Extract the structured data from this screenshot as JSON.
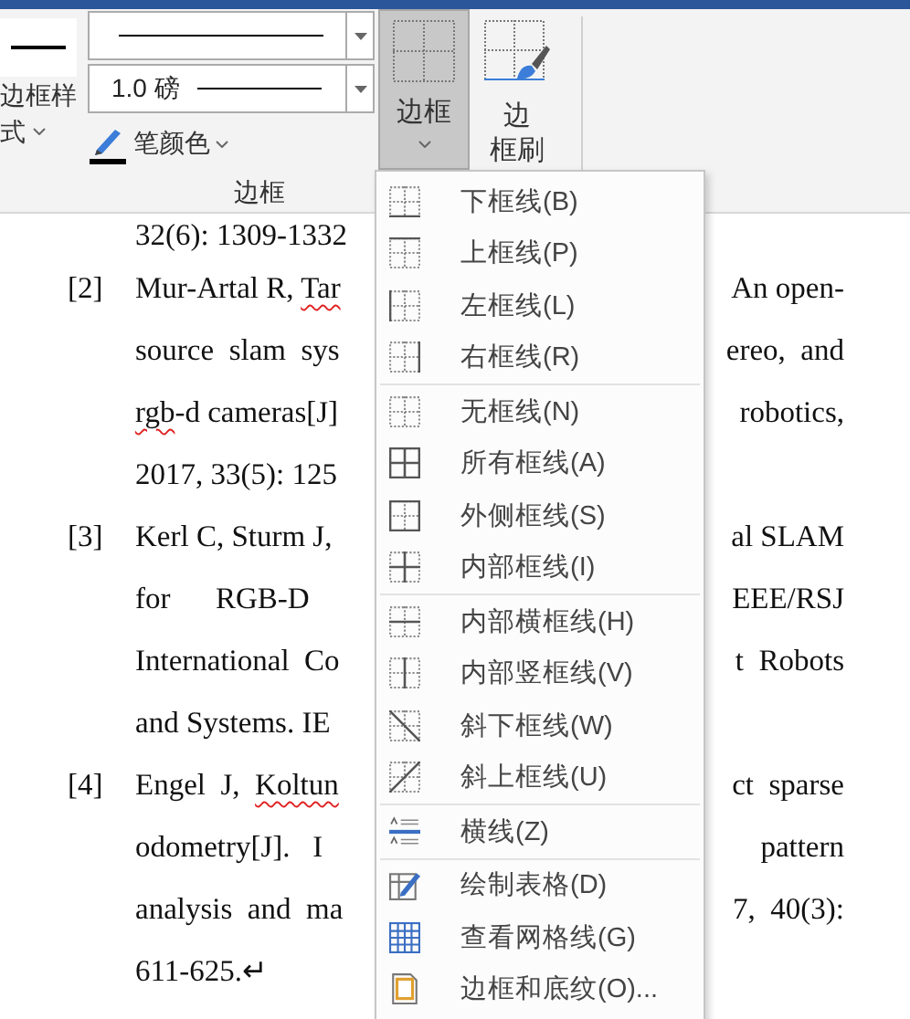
{
  "ribbon": {
    "border_style_button": {
      "label_lines": [
        "边框样",
        "式"
      ]
    },
    "line_weight_dropdown": {
      "value": "1.0 磅"
    },
    "pen_color_button": {
      "label": "笔颜色"
    },
    "borders_button": {
      "label": "边框",
      "pressed": true
    },
    "border_painter_button": {
      "label_lines": [
        "边",
        "框刷"
      ]
    },
    "group_label": "边框"
  },
  "document": {
    "top_fragment": "32(6): 1309-1332",
    "references": [
      {
        "number": "[2]",
        "lines": [
          {
            "left": [
              {
                "text": "Mur-Artal R, ",
                "misspelled": false
              },
              {
                "text": "Tar",
                "misspelled": true
              }
            ],
            "right": "An open-"
          },
          {
            "left": [
              {
                "text": "source  slam  sys",
                "misspelled": false
              }
            ],
            "right": "ereo,  and"
          },
          {
            "left": [
              {
                "text": "rgb",
                "misspelled": true
              },
              {
                "text": "-d cameras[J]",
                "misspelled": false
              }
            ],
            "right": "robotics,"
          },
          {
            "left": [
              {
                "text": "2017, 33(5): 125",
                "misspelled": false
              }
            ]
          }
        ]
      },
      {
        "number": "[3]",
        "lines": [
          {
            "left": [
              {
                "text": "Kerl C, Sturm J,",
                "misspelled": false
              }
            ],
            "right": "al SLAM"
          },
          {
            "left": [
              {
                "text": "for      RGB-D",
                "misspelled": false
              }
            ],
            "right": "EEE/RSJ"
          },
          {
            "left": [
              {
                "text": "International  Co",
                "misspelled": false
              }
            ],
            "right": "t  Robots"
          },
          {
            "left": [
              {
                "text": "and Systems. IE",
                "misspelled": false
              }
            ]
          }
        ]
      },
      {
        "number": "[4]",
        "lines": [
          {
            "left": [
              {
                "text": "Engel  J,  ",
                "misspelled": false
              },
              {
                "text": "Koltun",
                "misspelled": true
              }
            ],
            "right": "ct  sparse"
          },
          {
            "left": [
              {
                "text": "odometry[J].   I",
                "misspelled": false
              }
            ],
            "right": "pattern"
          },
          {
            "left": [
              {
                "text": "analysis  and  ma",
                "misspelled": false
              }
            ],
            "right": "7,  40(3):"
          },
          {
            "left": [
              {
                "text": "611-625.↵",
                "misspelled": false
              }
            ]
          }
        ]
      }
    ]
  },
  "borders_menu": {
    "sections": [
      [
        {
          "label": "下框线(B)",
          "kind": "bottom"
        },
        {
          "label": "上框线(P)",
          "kind": "top"
        },
        {
          "label": "左框线(L)",
          "kind": "left"
        },
        {
          "label": "右框线(R)",
          "kind": "right"
        }
      ],
      [
        {
          "label": "无框线(N)",
          "kind": "none"
        },
        {
          "label": "所有框线(A)",
          "kind": "all"
        },
        {
          "label": "外侧框线(S)",
          "kind": "outside"
        },
        {
          "label": "内部框线(I)",
          "kind": "inside"
        }
      ],
      [
        {
          "label": "内部横框线(H)",
          "kind": "inside-h"
        },
        {
          "label": "内部竖框线(V)",
          "kind": "inside-v"
        },
        {
          "label": "斜下框线(W)",
          "kind": "diag-down"
        },
        {
          "label": "斜上框线(U)",
          "kind": "diag-up"
        }
      ],
      [
        {
          "label": "横线(Z)",
          "kind": "hline"
        }
      ],
      [
        {
          "label": "绘制表格(D)",
          "kind": "draw"
        },
        {
          "label": "查看网格线(G)",
          "kind": "gridlines"
        },
        {
          "label": "边框和底纹(O)...",
          "kind": "shading"
        }
      ]
    ]
  }
}
